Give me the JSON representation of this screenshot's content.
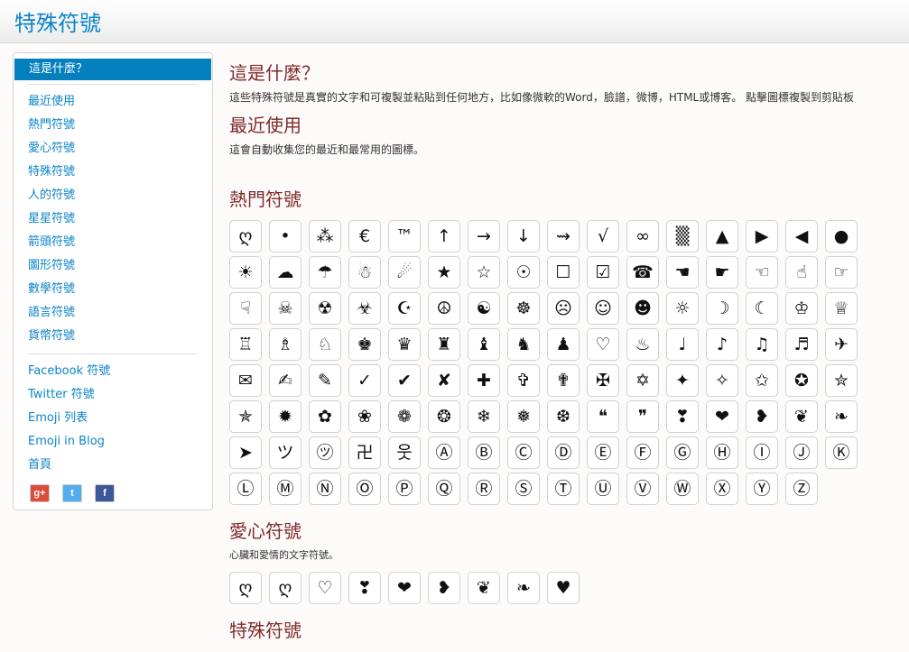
{
  "header": {
    "brand": "特殊符號"
  },
  "sidebar": {
    "active": "這是什麼？",
    "categories": [
      "最近使用",
      "熱門符號",
      "愛心符號",
      "特殊符號",
      "人的符號",
      "星星符號",
      "箭頭符號",
      "圖形符號",
      "數學符號",
      "語言符號",
      "貨幣符號"
    ],
    "links": [
      "Facebook 符號",
      "Twitter 符號",
      "Emoji 列表",
      "Emoji in Blog",
      "首頁"
    ],
    "social": [
      {
        "name": "google-plus-icon",
        "glyph": "g+"
      },
      {
        "name": "twitter-icon",
        "glyph": "t"
      },
      {
        "name": "facebook-icon",
        "glyph": "f"
      }
    ]
  },
  "main": {
    "what_title": "這是什麼？",
    "what_text": "這些特殊符號是真實的文字和可複製並粘貼到任何地方，比如像微軟的Word，臉譜，微博，HTML或博客。 點擊圖標複製到剪貼板",
    "recent_title": "最近使用",
    "recent_text": "這會自動收集您的最近和最常用的圖標。",
    "popular_title": "熱門符號",
    "popular": [
      "ღ",
      "•",
      "⁂",
      "€",
      "™",
      "↑",
      "→",
      "↓",
      "⇝",
      "√",
      "∞",
      "▒",
      "▲",
      "▶",
      "◀",
      "●",
      "☀",
      "☁",
      "☂",
      "☃",
      "☄",
      "★",
      "☆",
      "☉",
      "☐",
      "☑",
      "☎",
      "☚",
      "☛",
      "☜",
      "☝",
      "☞",
      "☟",
      "☠",
      "☢",
      "☣",
      "☪",
      "☮",
      "☯",
      "☸",
      "☹",
      "☺",
      "☻",
      "☼",
      "☽",
      "☾",
      "♔",
      "♕",
      "♖",
      "♗",
      "♘",
      "♚",
      "♛",
      "♜",
      "♝",
      "♞",
      "♟",
      "♡",
      "♨",
      "♩",
      "♪",
      "♫",
      "♬",
      "✈",
      "✉",
      "✍",
      "✎",
      "✓",
      "✔",
      "✘",
      "✚",
      "✞",
      "✟",
      "✠",
      "✡",
      "✦",
      "✧",
      "✩",
      "✪",
      "✮",
      "✯",
      "✹",
      "✿",
      "❀",
      "❁",
      "❂",
      "❄",
      "❅",
      "❆",
      "❝",
      "❞",
      "❣",
      "❤",
      "❥",
      "❦",
      "❧",
      "➤",
      "ツ",
      "㋡",
      "卍",
      "웃",
      "Ⓐ",
      "Ⓑ",
      "Ⓒ",
      "Ⓓ",
      "Ⓔ",
      "Ⓕ",
      "Ⓖ",
      "Ⓗ",
      "Ⓘ",
      "Ⓙ",
      "Ⓚ",
      "Ⓛ",
      "Ⓜ",
      "Ⓝ",
      "Ⓞ",
      "Ⓟ",
      "Ⓠ",
      "Ⓡ",
      "Ⓢ",
      "Ⓣ",
      "Ⓤ",
      "Ⓥ",
      "Ⓦ",
      "Ⓧ",
      "Ⓨ",
      "Ⓩ"
    ],
    "love_title": "愛心符號",
    "love_text": "心臟和愛情的文字符號。",
    "love": [
      "ღ",
      "ღ",
      "♡",
      "❣",
      "❤",
      "❥",
      "❦",
      "❧",
      "♥"
    ],
    "special_title": "特殊符號"
  }
}
